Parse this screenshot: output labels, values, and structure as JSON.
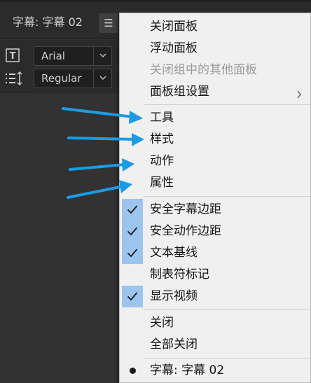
{
  "panel": {
    "title": "字幕: 字幕 02",
    "menu_icon": "hamburger-menu-icon",
    "font_family": "Arial",
    "font_style": "Regular"
  },
  "menu": {
    "group1": [
      {
        "label": "关闭面板",
        "enabled": true
      },
      {
        "label": "浮动面板",
        "enabled": true
      },
      {
        "label": "关闭组中的其他面板",
        "enabled": false
      },
      {
        "label": "面板组设置",
        "enabled": true,
        "submenu": true
      }
    ],
    "group2": [
      {
        "label": "工具"
      },
      {
        "label": "样式"
      },
      {
        "label": "动作"
      },
      {
        "label": "属性"
      }
    ],
    "group3": [
      {
        "label": "安全字幕边距",
        "checked": true
      },
      {
        "label": "安全动作边距",
        "checked": true
      },
      {
        "label": "文本基线",
        "checked": true
      },
      {
        "label": "制表符标记",
        "checked": false
      },
      {
        "label": "显示视频",
        "checked": true
      }
    ],
    "group4": [
      {
        "label": "关闭"
      },
      {
        "label": "全部关闭"
      }
    ],
    "group5": [
      {
        "label": "字幕: 字幕 02",
        "selected": true
      }
    ]
  },
  "colors": {
    "menu_bg": "#f0f0f0",
    "check_highlight": "#9bc5ef",
    "annotation_arrow": "#1a9be6",
    "panel_bg": "#323232"
  }
}
